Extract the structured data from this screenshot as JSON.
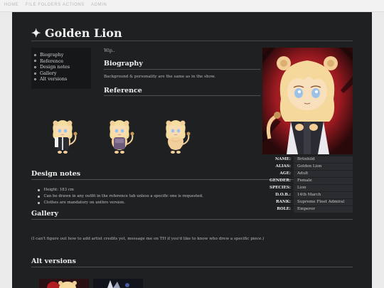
{
  "nav": {
    "items": [
      "HOME",
      "FILE FOLDERS",
      "ACTIONS",
      "ADMIN"
    ]
  },
  "page": {
    "title": "Golden Lion",
    "title_icon": "sparkle-icon"
  },
  "toc": {
    "items": [
      "Biography",
      "Reference",
      "Design notes",
      "Gallery",
      "Alt versions"
    ]
  },
  "wip": "Wip..",
  "biography": {
    "heading": "Biography",
    "text": "Background & personality are the same as in the show."
  },
  "reference": {
    "heading": "Reference"
  },
  "design_notes": {
    "heading": "Design notes",
    "items": [
      "Height: 183 cm",
      "Can be drawn in any outfit in the reference tab unless a specific one is requested.",
      "Clothes are mandatory on anthro version."
    ]
  },
  "gallery": {
    "heading": "Gallery",
    "note": "(I can't figure out how to add artist credits yet, message me on TH if you'd like to know who drew a specific piece.)"
  },
  "alt_versions": {
    "heading": "Alt versions"
  },
  "infobox": {
    "rows": [
      {
        "key": "NAME:",
        "value": "Brünhild"
      },
      {
        "key": "ALIAS:",
        "value": "Golden Lion"
      },
      {
        "key": "AGE:",
        "value": "Adult"
      },
      {
        "key": "GENDER:",
        "value": "Female"
      },
      {
        "key": "SPECIES:",
        "value": "Lion"
      },
      {
        "key": "D.O.B.:",
        "value": "14th March"
      },
      {
        "key": "RANK:",
        "value": "Supreme Fleet Admiral"
      },
      {
        "key": "ROLE:",
        "value": "Emperor"
      }
    ]
  },
  "colors": {
    "page_bg": "#1f2022",
    "portrait_bg": "#b31b21",
    "fur": "#f3cf9c",
    "hair": "#f5dc9f",
    "eyes": "#9dc2e8"
  }
}
